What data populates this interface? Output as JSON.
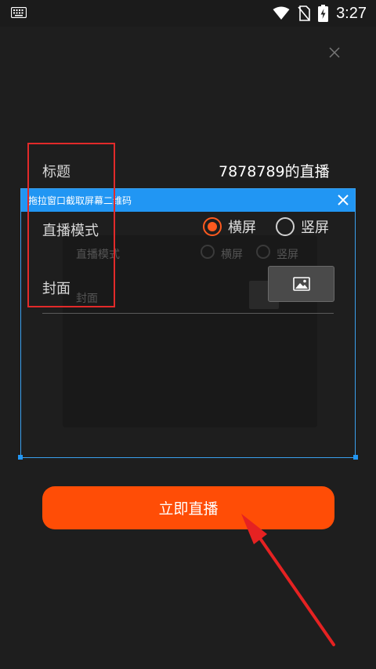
{
  "status_bar": {
    "time": "3:27"
  },
  "form": {
    "title_label": "标题",
    "title_value": "7878789的直播",
    "mode_label": "直播模式",
    "mode_options": [
      {
        "label": "横屏",
        "selected": true
      },
      {
        "label": "竖屏",
        "selected": false
      }
    ],
    "cover_label": "封面"
  },
  "capture_overlay": {
    "title": "拖拉窗口截取屏幕二维码"
  },
  "ghost_preview": {
    "mode_label": "直播模式",
    "options": [
      "横屏",
      "竖屏"
    ],
    "cover_label": "封面"
  },
  "primary_button": {
    "label": "立即直播",
    "color": "#ff4d06"
  },
  "colors": {
    "accent": "#ff5a1f",
    "overlay": "#2196f3",
    "annotation": "#e22a2a"
  }
}
